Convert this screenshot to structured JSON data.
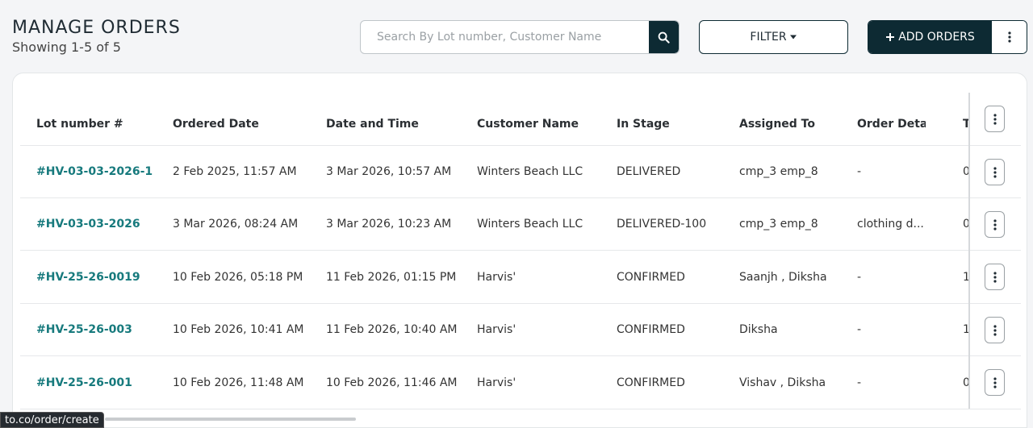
{
  "header": {
    "title": "MANAGE ORDERS",
    "subtitle": "Showing 1-5 of 5",
    "search_placeholder": "Search By Lot number, Customer Name",
    "filter_label": "FILTER",
    "add_label": "ADD ORDERS"
  },
  "table": {
    "columns": [
      "Lot number #",
      "Ordered Date",
      "Date and Time",
      "Customer Name",
      "In Stage",
      "Assigned To",
      "Order Detail",
      "T"
    ],
    "rows": [
      {
        "lot": "#HV-03-03-2026-1",
        "ordered": "2 Feb 2025, 11:57 AM",
        "datetime": "3 Mar 2026, 10:57 AM",
        "customer": "Winters Beach LLC",
        "stage": "DELIVERED",
        "assigned": "cmp_3 emp_8",
        "detail": "-",
        "extra": "0"
      },
      {
        "lot": "#HV-03-03-2026",
        "ordered": "3 Mar 2026, 08:24 AM",
        "datetime": "3 Mar 2026, 10:23 AM",
        "customer": "Winters Beach LLC",
        "stage": "DELIVERED-100",
        "assigned": "cmp_3 emp_8",
        "detail": "clothing d...",
        "extra": "0"
      },
      {
        "lot": "#HV-25-26-0019",
        "ordered": "10 Feb 2026, 05:18 PM",
        "datetime": "11 Feb 2026, 01:15 PM",
        "customer": "Harvis'",
        "stage": "CONFIRMED",
        "assigned": "Saanjh , Diksha",
        "detail": "-",
        "extra": "1"
      },
      {
        "lot": "#HV-25-26-003",
        "ordered": "10 Feb 2026, 10:41 AM",
        "datetime": "11 Feb 2026, 10:40 AM",
        "customer": "Harvis'",
        "stage": "CONFIRMED",
        "assigned": "Diksha",
        "detail": "-",
        "extra": "1"
      },
      {
        "lot": "#HV-25-26-001",
        "ordered": "10 Feb 2026, 11:48 AM",
        "datetime": "10 Feb 2026, 11:46 AM",
        "customer": "Harvis'",
        "stage": "CONFIRMED",
        "assigned": "Vishav , Diksha",
        "detail": "-",
        "extra": "0"
      }
    ]
  },
  "status_url": "to.co/order/create",
  "icons": {
    "search": "search-icon",
    "filter": "caret-down-icon",
    "add": "plus-icon",
    "more": "kebab-icon"
  },
  "colors": {
    "primary": "#0d2a33",
    "link": "#177a7d"
  }
}
